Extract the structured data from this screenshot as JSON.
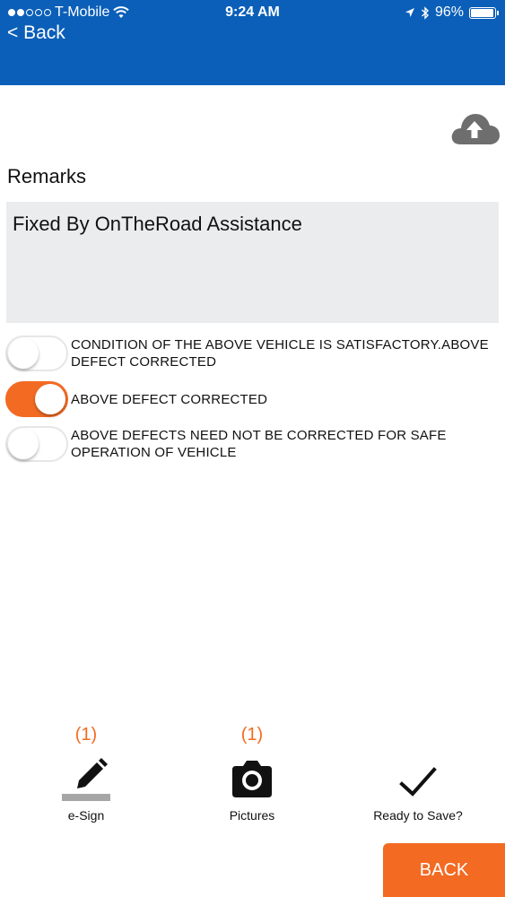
{
  "status_bar": {
    "carrier": "T-Mobile",
    "time": "9:24 AM",
    "battery": "96%",
    "signal_bars_filled": 2,
    "signal_bars_total": 5
  },
  "header": {
    "back_label": "< Back",
    "color": "#0b5fb8"
  },
  "upload": {
    "icon": "cloud-upload-icon"
  },
  "remarks": {
    "label": "Remarks",
    "value": "Fixed By OnTheRoad Assistance"
  },
  "toggles": [
    {
      "label": "CONDITION OF THE ABOVE VEHICLE IS SATISFACTORY.ABOVE DEFECT CORRECTED",
      "on": false
    },
    {
      "label": "ABOVE DEFECT CORRECTED",
      "on": true
    },
    {
      "label": "ABOVE DEFECTS NEED NOT BE CORRECTED FOR SAFE OPERATION OF VEHICLE",
      "on": false
    }
  ],
  "bottom_bar": {
    "esign": {
      "count": "(1)",
      "label": "e-Sign",
      "icon": "pencil-icon"
    },
    "pictures": {
      "count": "(1)",
      "label": "Pictures",
      "icon": "camera-icon"
    },
    "ready": {
      "label": "Ready to Save?",
      "icon": "checkmark-icon"
    }
  },
  "back_button": {
    "label": "BACK"
  },
  "colors": {
    "accent": "#f36a22",
    "header": "#0b5fb8",
    "field_bg": "#ebecee"
  }
}
